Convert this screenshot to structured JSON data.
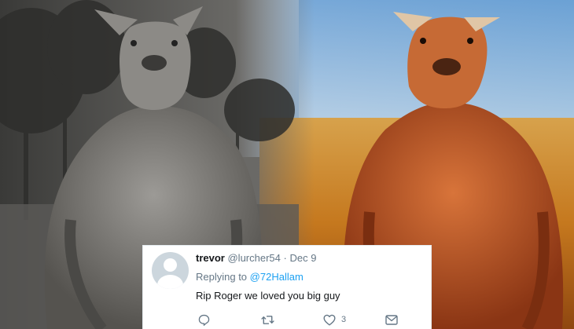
{
  "tweet": {
    "display_name": "trevor",
    "handle": "@lurcher54",
    "separator": "·",
    "date": "Dec 9",
    "replying_to_prefix": "Replying to",
    "replying_to_handle": "@72Hallam",
    "text": "Rip Roger we loved you big guy",
    "actions": {
      "reply_icon": "reply-icon",
      "retweet_icon": "retweet-icon",
      "like_icon": "heart-icon",
      "like_count": "3",
      "message_icon": "envelope-icon"
    }
  },
  "colors": {
    "link": "#1da1f2",
    "name": "#14171a",
    "meta": "#657786"
  }
}
